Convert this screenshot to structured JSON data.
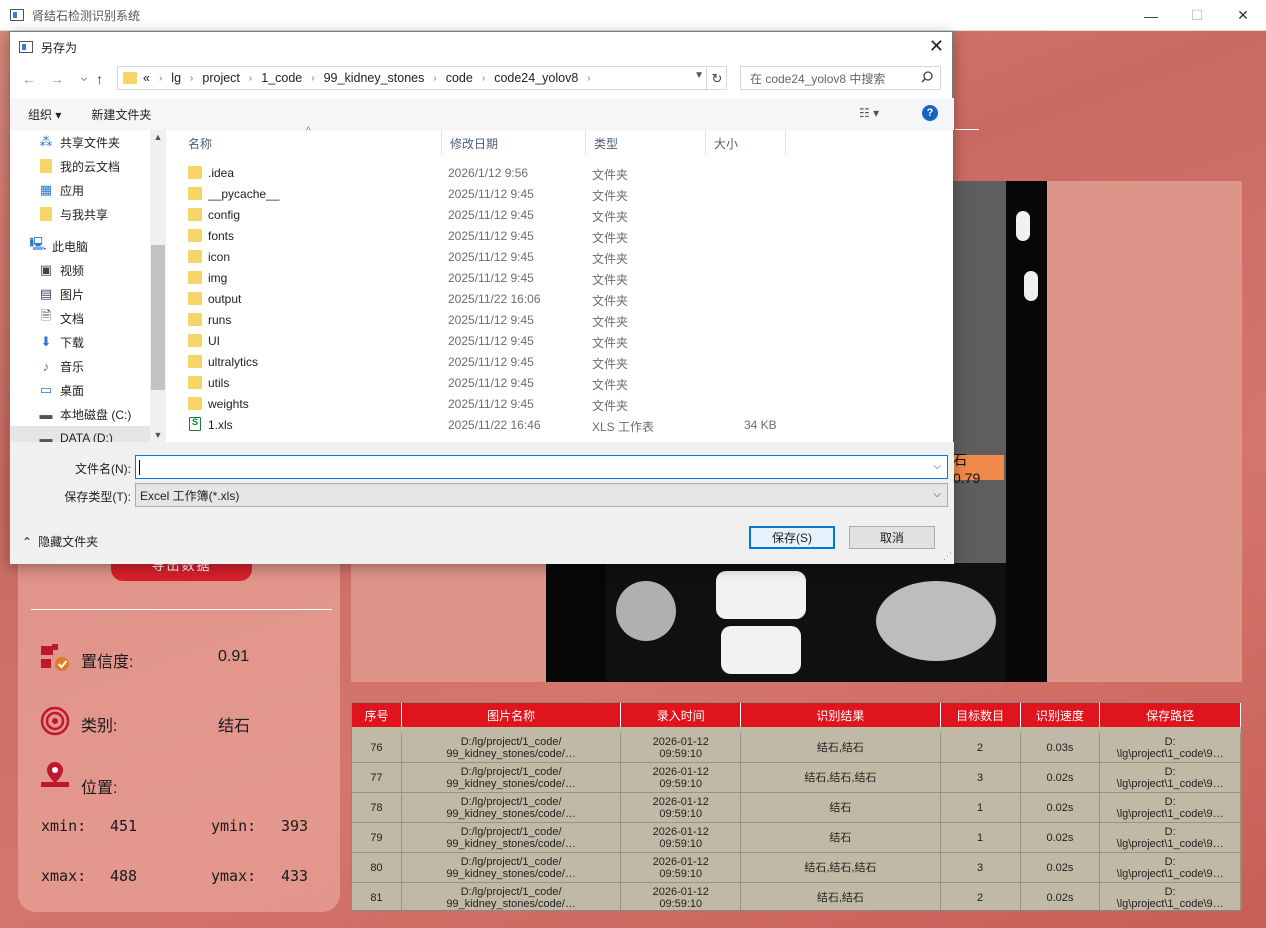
{
  "app": {
    "title": "肾结石检测识别系统",
    "minimize": "—",
    "maximize": "☐",
    "close": "✕"
  },
  "detection": {
    "label": "石 0.79"
  },
  "left_panel": {
    "export_button": "导出数据",
    "confidence_label": "置信度:",
    "confidence_value": "0.91",
    "class_label": "类别:",
    "class_value": "结石",
    "position_label": "位置:",
    "xmin_label": "xmin:",
    "xmin_value": "451",
    "ymin_label": "ymin:",
    "ymin_value": "393",
    "xmax_label": "xmax:",
    "xmax_value": "488",
    "ymax_label": "ymax:",
    "ymax_value": "433"
  },
  "table": {
    "headers": [
      "序号",
      "图片名称",
      "录入时间",
      "识别结果",
      "目标数目",
      "识别速度",
      "保存路径"
    ],
    "rows": [
      [
        "76",
        "D:/lg/project/1_code/\n99_kidney_stones/code/…",
        "2026-01-12\n09:59:10",
        "结石,结石",
        "2",
        "0.03s",
        "D:\n\\lg\\project\\1_code\\9…"
      ],
      [
        "77",
        "D:/lg/project/1_code/\n99_kidney_stones/code/…",
        "2026-01-12\n09:59:10",
        "结石,结石,结石",
        "3",
        "0.02s",
        "D:\n\\lg\\project\\1_code\\9…"
      ],
      [
        "78",
        "D:/lg/project/1_code/\n99_kidney_stones/code/…",
        "2026-01-12\n09:59:10",
        "结石",
        "1",
        "0.02s",
        "D:\n\\lg\\project\\1_code\\9…"
      ],
      [
        "79",
        "D:/lg/project/1_code/\n99_kidney_stones/code/…",
        "2026-01-12\n09:59:10",
        "结石",
        "1",
        "0.02s",
        "D:\n\\lg\\project\\1_code\\9…"
      ],
      [
        "80",
        "D:/lg/project/1_code/\n99_kidney_stones/code/…",
        "2026-01-12\n09:59:10",
        "结石,结石,结石",
        "3",
        "0.02s",
        "D:\n\\lg\\project\\1_code\\9…"
      ],
      [
        "81",
        "D:/lg/project/1_code/\n99_kidney_stones/code/…",
        "2026-01-12\n09:59:10",
        "结石,结石",
        "2",
        "0.02s",
        "D:\n\\lg\\project\\1_code\\9…"
      ]
    ]
  },
  "dialog": {
    "title": "另存为",
    "close": "✕",
    "nav": {
      "back": "←",
      "forward": "→",
      "recent": "⌄",
      "up": "↑"
    },
    "breadcrumb": [
      "«",
      "lg",
      "project",
      "1_code",
      "99_kidney_stones",
      "code",
      "code24_yolov8"
    ],
    "search_placeholder": "在 code24_yolov8 中搜索",
    "toolbar": {
      "organize": "组织 ▾",
      "new_folder": "新建文件夹",
      "view": "☷ ▾",
      "help": "?"
    },
    "nav_items": [
      {
        "label": "共享文件夹",
        "icon": "share-icon"
      },
      {
        "label": "我的云文档",
        "icon": "cloud-doc-icon"
      },
      {
        "label": "应用",
        "icon": "apps-icon"
      },
      {
        "label": "与我共享",
        "icon": "shared-with-me-icon"
      },
      {
        "label": "此电脑",
        "icon": "computer-icon"
      },
      {
        "label": "视频",
        "icon": "video-icon"
      },
      {
        "label": "图片",
        "icon": "picture-icon"
      },
      {
        "label": "文档",
        "icon": "document-icon"
      },
      {
        "label": "下载",
        "icon": "download-icon"
      },
      {
        "label": "音乐",
        "icon": "music-icon"
      },
      {
        "label": "桌面",
        "icon": "desktop-icon"
      },
      {
        "label": "本地磁盘 (C:)",
        "icon": "drive-c-icon"
      },
      {
        "label": "DATA (D:)",
        "icon": "drive-d-icon"
      }
    ],
    "columns": {
      "name": "名称",
      "date": "修改日期",
      "type": "类型",
      "size": "大小"
    },
    "files": [
      {
        "name": ".idea",
        "date": "2026/1/12 9:56",
        "type": "文件夹",
        "size": ""
      },
      {
        "name": "__pycache__",
        "date": "2025/11/12 9:45",
        "type": "文件夹",
        "size": ""
      },
      {
        "name": "config",
        "date": "2025/11/12 9:45",
        "type": "文件夹",
        "size": ""
      },
      {
        "name": "fonts",
        "date": "2025/11/12 9:45",
        "type": "文件夹",
        "size": ""
      },
      {
        "name": "icon",
        "date": "2025/11/12 9:45",
        "type": "文件夹",
        "size": ""
      },
      {
        "name": "img",
        "date": "2025/11/12 9:45",
        "type": "文件夹",
        "size": ""
      },
      {
        "name": "output",
        "date": "2025/11/22 16:06",
        "type": "文件夹",
        "size": ""
      },
      {
        "name": "runs",
        "date": "2025/11/12 9:45",
        "type": "文件夹",
        "size": ""
      },
      {
        "name": "UI",
        "date": "2025/11/12 9:45",
        "type": "文件夹",
        "size": ""
      },
      {
        "name": "ultralytics",
        "date": "2025/11/12 9:45",
        "type": "文件夹",
        "size": ""
      },
      {
        "name": "utils",
        "date": "2025/11/12 9:45",
        "type": "文件夹",
        "size": ""
      },
      {
        "name": "weights",
        "date": "2025/11/12 9:45",
        "type": "文件夹",
        "size": ""
      },
      {
        "name": "1.xls",
        "date": "2025/11/22 16:46",
        "type": "XLS 工作表",
        "size": "34 KB"
      }
    ],
    "filename_label": "文件名(N):",
    "filename_value": "",
    "filetype_label": "保存类型(T):",
    "filetype_value": "Excel 工作簿(*.xls)",
    "hide_folders": "隐藏文件夹",
    "save_button": "保存(S)",
    "cancel_button": "取消"
  }
}
